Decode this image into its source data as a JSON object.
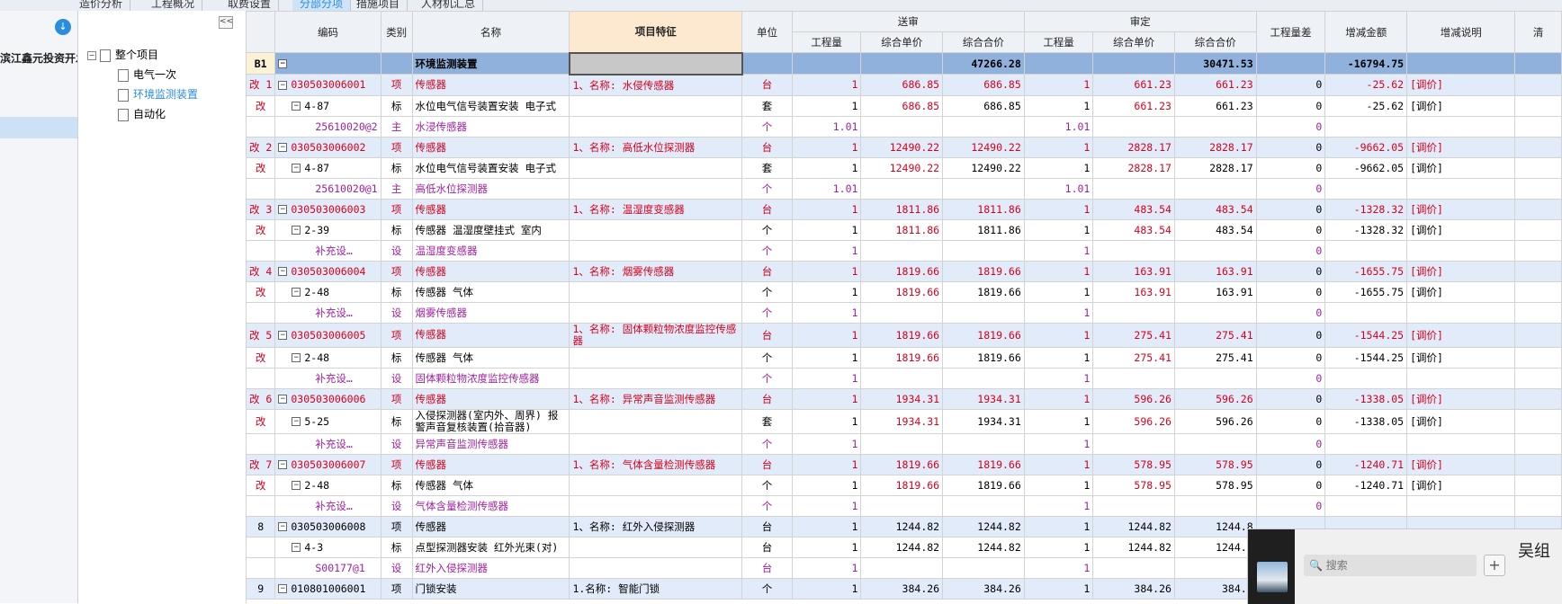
{
  "top_tabs": [
    "造价分析",
    "工程概况",
    "取费设置",
    "分部分项",
    "措施项目",
    "人材机汇总"
  ],
  "left": {
    "project_name": "滨江鑫元投资开发…"
  },
  "tree": {
    "collapse_label": "<<",
    "root": "整个项目",
    "items": [
      "电气一次",
      "环境监测装置",
      "自动化"
    ]
  },
  "table": {
    "headers": {
      "code": "编码",
      "cat": "类别",
      "name": "名称",
      "feature": "项目特征",
      "unit": "单位",
      "sent": "送审",
      "audit": "审定",
      "qty": "工程量",
      "uprice": "综合单价",
      "total": "综合合价",
      "qdiff": "工程量差",
      "inc": "增减金额",
      "note": "增减说明",
      "last": "清"
    },
    "rows": [
      {
        "t": "b1",
        "mark": "B1",
        "name": "环境监测装置",
        "feature": "",
        "s_total": "47266.28",
        "a_total": "30471.53",
        "inc": "-16794.75"
      },
      {
        "t": "q",
        "mark": "改 1",
        "code": "030503006001",
        "cat": "项",
        "name": "传感器",
        "feature": "1、名称: 水侵传感器",
        "unit": "台",
        "s_qty": "1",
        "s_up": "686.85",
        "s_total": "686.85",
        "a_qty": "1",
        "a_up": "661.23",
        "a_total": "661.23",
        "diff": "0",
        "inc": "-25.62",
        "note": "[调价]"
      },
      {
        "t": "d",
        "mark": "改",
        "code": "4-87",
        "cat": "标",
        "name": "水位电气信号装置安装 电子式",
        "unit": "套",
        "s_qty": "1",
        "s_up": "686.85",
        "s_total": "686.85",
        "a_qty": "1",
        "a_up": "661.23",
        "a_total": "661.23",
        "diff": "0",
        "inc": "-25.62",
        "note": "[调价]"
      },
      {
        "t": "m",
        "mark": "",
        "code": "25610020@2",
        "cat": "主",
        "name": "水浸传感器",
        "unit": "个",
        "s_qty": "1.01",
        "a_qty": "1.01",
        "diff": "0"
      },
      {
        "t": "q",
        "mark": "改 2",
        "code": "030503006002",
        "cat": "项",
        "name": "传感器",
        "feature": "1、名称: 高低水位探测器",
        "unit": "台",
        "s_qty": "1",
        "s_up": "12490.22",
        "s_total": "12490.22",
        "a_qty": "1",
        "a_up": "2828.17",
        "a_total": "2828.17",
        "diff": "0",
        "inc": "-9662.05",
        "note": "[调价]"
      },
      {
        "t": "d",
        "mark": "改",
        "code": "4-87",
        "cat": "标",
        "name": "水位电气信号装置安装 电子式",
        "unit": "套",
        "s_qty": "1",
        "s_up": "12490.22",
        "s_total": "12490.22",
        "a_qty": "1",
        "a_up": "2828.17",
        "a_total": "2828.17",
        "diff": "0",
        "inc": "-9662.05",
        "note": "[调价]"
      },
      {
        "t": "m",
        "mark": "",
        "code": "25610020@1",
        "cat": "主",
        "name": "高低水位探测器",
        "unit": "个",
        "s_qty": "1.01",
        "a_qty": "1.01",
        "diff": "0"
      },
      {
        "t": "q",
        "mark": "改 3",
        "code": "030503006003",
        "cat": "项",
        "name": "传感器",
        "feature": "1、名称: 温湿度变感器",
        "unit": "台",
        "s_qty": "1",
        "s_up": "1811.86",
        "s_total": "1811.86",
        "a_qty": "1",
        "a_up": "483.54",
        "a_total": "483.54",
        "diff": "0",
        "inc": "-1328.32",
        "note": "[调价]"
      },
      {
        "t": "d",
        "mark": "改",
        "code": "2-39",
        "cat": "标",
        "name": "传感器 温湿度壁挂式 室内",
        "unit": "个",
        "s_qty": "1",
        "s_up": "1811.86",
        "s_total": "1811.86",
        "a_qty": "1",
        "a_up": "483.54",
        "a_total": "483.54",
        "diff": "0",
        "inc": "-1328.32",
        "note": "[调价]"
      },
      {
        "t": "m",
        "mark": "",
        "code": "补充设…",
        "cat": "设",
        "name": "温湿度变感器",
        "unit": "个",
        "s_qty": "1",
        "a_qty": "1",
        "diff": "0"
      },
      {
        "t": "q",
        "mark": "改 4",
        "code": "030503006004",
        "cat": "项",
        "name": "传感器",
        "feature": "1、名称: 烟雾传感器",
        "unit": "台",
        "s_qty": "1",
        "s_up": "1819.66",
        "s_total": "1819.66",
        "a_qty": "1",
        "a_up": "163.91",
        "a_total": "163.91",
        "diff": "0",
        "inc": "-1655.75",
        "note": "[调价]"
      },
      {
        "t": "d",
        "mark": "改",
        "code": "2-48",
        "cat": "标",
        "name": "传感器 气体",
        "unit": "个",
        "s_qty": "1",
        "s_up": "1819.66",
        "s_total": "1819.66",
        "a_qty": "1",
        "a_up": "163.91",
        "a_total": "163.91",
        "diff": "0",
        "inc": "-1655.75",
        "note": "[调价]"
      },
      {
        "t": "m",
        "mark": "",
        "code": "补充设…",
        "cat": "设",
        "name": "烟雾传感器",
        "unit": "个",
        "s_qty": "1",
        "a_qty": "1",
        "diff": "0"
      },
      {
        "t": "q",
        "tall": true,
        "mark": "改 5",
        "code": "030503006005",
        "cat": "项",
        "name": "传感器",
        "feature": "1、名称: 固体颗粒物浓度监控传感器",
        "unit": "台",
        "s_qty": "1",
        "s_up": "1819.66",
        "s_total": "1819.66",
        "a_qty": "1",
        "a_up": "275.41",
        "a_total": "275.41",
        "diff": "0",
        "inc": "-1544.25",
        "note": "[调价]"
      },
      {
        "t": "d",
        "mark": "改",
        "code": "2-48",
        "cat": "标",
        "name": "传感器 气体",
        "unit": "个",
        "s_qty": "1",
        "s_up": "1819.66",
        "s_total": "1819.66",
        "a_qty": "1",
        "a_up": "275.41",
        "a_total": "275.41",
        "diff": "0",
        "inc": "-1544.25",
        "note": "[调价]"
      },
      {
        "t": "m",
        "mark": "",
        "code": "补充设…",
        "cat": "设",
        "name": "固体颗粒物浓度监控传感器",
        "unit": "个",
        "s_qty": "1",
        "a_qty": "1",
        "diff": "0"
      },
      {
        "t": "q",
        "mark": "改 6",
        "code": "030503006006",
        "cat": "项",
        "name": "传感器",
        "feature": "1、名称: 异常声音监测传感器",
        "unit": "台",
        "s_qty": "1",
        "s_up": "1934.31",
        "s_total": "1934.31",
        "a_qty": "1",
        "a_up": "596.26",
        "a_total": "596.26",
        "diff": "0",
        "inc": "-1338.05",
        "note": "[调价]"
      },
      {
        "t": "d",
        "tall": true,
        "mark": "改",
        "code": "5-25",
        "cat": "标",
        "name": "入侵探测器(室内外、周界) 报警声音复核装置(拾音器)",
        "unit": "套",
        "s_qty": "1",
        "s_up": "1934.31",
        "s_total": "1934.31",
        "a_qty": "1",
        "a_up": "596.26",
        "a_total": "596.26",
        "diff": "0",
        "inc": "-1338.05",
        "note": "[调价]"
      },
      {
        "t": "m",
        "mark": "",
        "code": "补充设…",
        "cat": "设",
        "name": "异常声音监测传感器",
        "unit": "个",
        "s_qty": "1",
        "a_qty": "1",
        "diff": "0"
      },
      {
        "t": "q",
        "mark": "改 7",
        "code": "030503006007",
        "cat": "项",
        "name": "传感器",
        "feature": "1、名称: 气体含量检测传感器",
        "unit": "台",
        "s_qty": "1",
        "s_up": "1819.66",
        "s_total": "1819.66",
        "a_qty": "1",
        "a_up": "578.95",
        "a_total": "578.95",
        "diff": "0",
        "inc": "-1240.71",
        "note": "[调价]"
      },
      {
        "t": "d",
        "mark": "改",
        "code": "2-48",
        "cat": "标",
        "name": "传感器 气体",
        "unit": "个",
        "s_qty": "1",
        "s_up": "1819.66",
        "s_total": "1819.66",
        "a_qty": "1",
        "a_up": "578.95",
        "a_total": "578.95",
        "diff": "0",
        "inc": "-1240.71",
        "note": "[调价]"
      },
      {
        "t": "m",
        "mark": "",
        "code": "补充设…",
        "cat": "设",
        "name": "气体含量检测传感器",
        "unit": "个",
        "s_qty": "1",
        "a_qty": "1",
        "diff": "0"
      },
      {
        "t": "q",
        "plain": true,
        "mark": "8",
        "code": "030503006008",
        "cat": "项",
        "name": "传感器",
        "feature": "1、名称: 红外入侵探测器",
        "unit": "台",
        "s_qty": "1",
        "s_up": "1244.82",
        "s_total": "1244.82",
        "a_qty": "1",
        "a_up": "1244.82",
        "a_total": "1244.8"
      },
      {
        "t": "d",
        "plain": true,
        "mark": "",
        "code": "4-3",
        "cat": "标",
        "name": "点型探测器安装 红外光束(对)",
        "unit": "台",
        "s_qty": "1",
        "s_up": "1244.82",
        "s_total": "1244.82",
        "a_qty": "1",
        "a_up": "1244.82",
        "a_total": "1244.8"
      },
      {
        "t": "m",
        "mark": "",
        "code": "S00177@1",
        "cat": "设",
        "name": "红外入侵探测器",
        "unit": "台",
        "s_qty": "1",
        "a_qty": "1"
      },
      {
        "t": "q",
        "plain": true,
        "mark": "9",
        "code": "010801006001",
        "cat": "项",
        "name": "门锁安装",
        "feature": "1.名称: 智能门锁",
        "unit": "个",
        "s_qty": "1",
        "s_up": "384.26",
        "s_total": "384.26",
        "a_qty": "1",
        "a_up": "384.26",
        "a_total": "384.2"
      }
    ]
  },
  "popup": {
    "search_placeholder": "搜索",
    "plus": "+",
    "title": "吴组"
  }
}
